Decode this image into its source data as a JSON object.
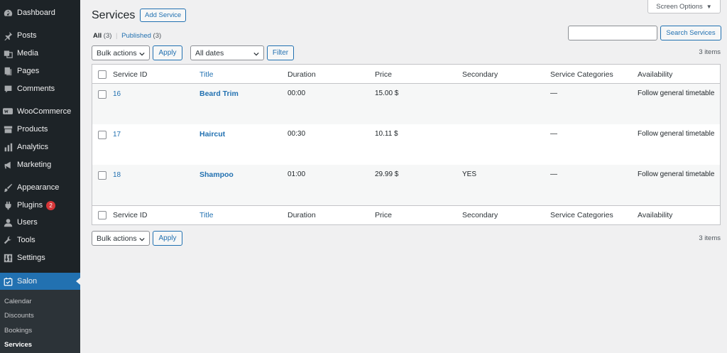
{
  "sidebar": {
    "items": [
      {
        "label": "Dashboard",
        "icon": "dashboard-icon"
      },
      {
        "label": "Posts",
        "icon": "pin-icon"
      },
      {
        "label": "Media",
        "icon": "media-icon"
      },
      {
        "label": "Pages",
        "icon": "pages-icon"
      },
      {
        "label": "Comments",
        "icon": "comment-icon"
      },
      {
        "label": "WooCommerce",
        "icon": "woo-icon"
      },
      {
        "label": "Products",
        "icon": "archive-icon"
      },
      {
        "label": "Analytics",
        "icon": "bar-chart-icon"
      },
      {
        "label": "Marketing",
        "icon": "megaphone-icon"
      },
      {
        "label": "Appearance",
        "icon": "brush-icon"
      },
      {
        "label": "Plugins",
        "icon": "plug-icon",
        "badge": "2"
      },
      {
        "label": "Users",
        "icon": "user-icon"
      },
      {
        "label": "Tools",
        "icon": "wrench-icon"
      },
      {
        "label": "Settings",
        "icon": "settings-icon"
      },
      {
        "label": "Salon",
        "icon": "calendar-icon"
      }
    ],
    "submenu": [
      "Calendar",
      "Discounts",
      "Bookings",
      "Services"
    ]
  },
  "header": {
    "title": "Services",
    "add_button": "Add Service",
    "screen_options": "Screen Options"
  },
  "filters": {
    "all_label": "All",
    "all_count": "(3)",
    "separator": "|",
    "published_label": "Published",
    "published_count": "(3)",
    "bulk_actions": "Bulk actions",
    "apply": "Apply",
    "all_dates": "All dates",
    "filter": "Filter",
    "search_value": "",
    "search_button": "Search Services",
    "items_count": "3 items"
  },
  "table": {
    "columns": [
      "Service ID",
      "Title",
      "Duration",
      "Price",
      "Secondary",
      "Service Categories",
      "Availability"
    ],
    "rows": [
      {
        "id": "16",
        "title": "Beard Trim",
        "duration": "00:00",
        "price": "15.00 $",
        "secondary": "",
        "categories": "—",
        "availability": "Follow general timetable"
      },
      {
        "id": "17",
        "title": "Haircut",
        "duration": "00:30",
        "price": "10.11 $",
        "secondary": "",
        "categories": "—",
        "availability": "Follow general timetable"
      },
      {
        "id": "18",
        "title": "Shampoo",
        "duration": "01:00",
        "price": "29.99 $",
        "secondary": "YES",
        "categories": "—",
        "availability": "Follow general timetable"
      }
    ]
  },
  "colors": {
    "sidebar_bg": "#1d2327",
    "accent": "#2271b1",
    "badge": "#d63638"
  }
}
